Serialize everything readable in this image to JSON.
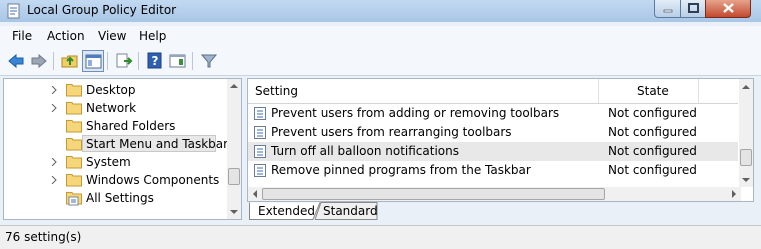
{
  "window": {
    "title": "Local Group Policy Editor"
  },
  "menu": [
    "File",
    "Action",
    "View",
    "Help"
  ],
  "tree": {
    "items": [
      {
        "label": "Desktop",
        "expandable": true,
        "selected": false
      },
      {
        "label": "Network",
        "expandable": true,
        "selected": false
      },
      {
        "label": "Shared Folders",
        "expandable": false,
        "selected": false
      },
      {
        "label": "Start Menu and Taskbar",
        "expandable": false,
        "selected": true
      },
      {
        "label": "System",
        "expandable": true,
        "selected": false
      },
      {
        "label": "Windows Components",
        "expandable": true,
        "selected": false
      },
      {
        "label": "All Settings",
        "expandable": false,
        "selected": false
      }
    ]
  },
  "details": {
    "columns": {
      "setting": "Setting",
      "state": "State"
    },
    "rows": [
      {
        "setting": "Prevent users from adding or removing toolbars",
        "state": "Not configured"
      },
      {
        "setting": "Prevent users from rearranging toolbars",
        "state": "Not configured"
      },
      {
        "setting": "Turn off all balloon notifications",
        "state": "Not configured"
      },
      {
        "setting": "Remove pinned programs from the Taskbar",
        "state": "Not configured"
      }
    ]
  },
  "tabs": {
    "extended": "Extended",
    "standard": "Standard"
  },
  "status": {
    "text": "76 setting(s)"
  },
  "colors": {
    "titlebar": "#b8d1ee",
    "selection": "#e8e8e8",
    "close": "#c24a2e"
  }
}
